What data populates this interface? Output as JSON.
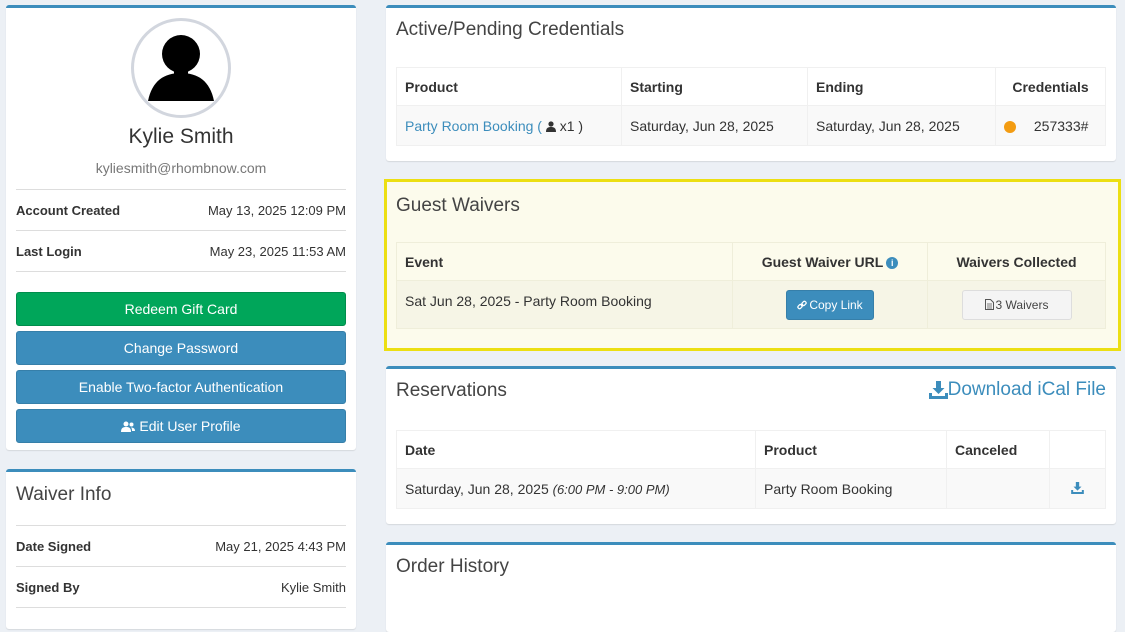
{
  "profile": {
    "name": "Kylie Smith",
    "email": "kyliesmith@rhombnow.com",
    "account_created_label": "Account Created",
    "account_created_value": "May 13, 2025 12:09 PM",
    "last_login_label": "Last Login",
    "last_login_value": "May 23, 2025 11:53 AM",
    "buttons": {
      "redeem": "Redeem Gift Card",
      "change_password": "Change Password",
      "two_factor": "Enable Two-factor Authentication",
      "edit_profile": "Edit User Profile"
    }
  },
  "waiver_info": {
    "title": "Waiver Info",
    "date_signed_label": "Date Signed",
    "date_signed_value": "May 21, 2025 4:43 PM",
    "signed_by_label": "Signed By",
    "signed_by_value": "Kylie Smith"
  },
  "credentials": {
    "title": "Active/Pending Credentials",
    "headers": [
      "Product",
      "Starting",
      "Ending",
      "Credentials"
    ],
    "row": {
      "product": "Party Room Booking",
      "open_paren": "(",
      "qty": "x1 )",
      "starting": "Saturday, Jun 28, 2025",
      "ending": "Saturday, Jun 28, 2025",
      "credential": "257333#",
      "status_color": "#f39c12"
    }
  },
  "guest_waivers": {
    "title": "Guest Waivers",
    "headers": [
      "Event",
      "Guest Waiver URL",
      "Waivers Collected"
    ],
    "row": {
      "event": "Sat Jun 28, 2025 - Party Room Booking",
      "copy_link": "Copy Link",
      "waivers": "3 Waivers"
    },
    "highlight_color": "#ecdf12"
  },
  "reservations": {
    "title": "Reservations",
    "download_label": "Download iCal File",
    "headers": [
      "Date",
      "Product",
      "Canceled",
      ""
    ],
    "row": {
      "date": "Saturday, Jun 28, 2025",
      "time": "(6:00 PM - 9:00 PM)",
      "product": "Party Room Booking",
      "canceled": ""
    }
  },
  "order_history": {
    "title": "Order History"
  },
  "colors": {
    "primary": "#3c8dbc",
    "success": "#00a65a",
    "background": "#ecf0f5"
  },
  "icons": [
    "user-silhouette-icon",
    "user-icon",
    "users-icon",
    "link-icon",
    "file-icon",
    "info-icon",
    "download-icon"
  ]
}
